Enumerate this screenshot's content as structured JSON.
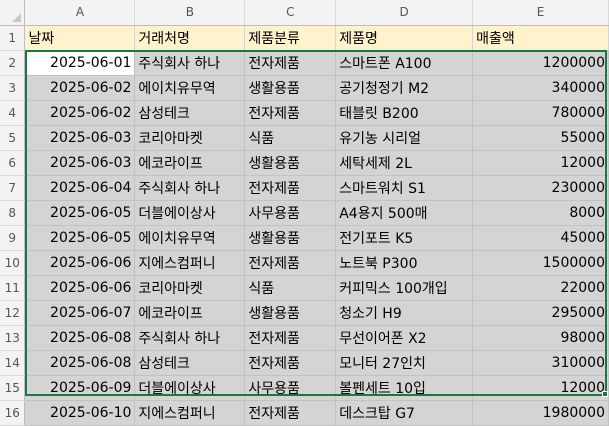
{
  "columns": [
    "A",
    "B",
    "C",
    "D",
    "E"
  ],
  "header": {
    "row_num": "1",
    "cells": [
      "날짜",
      "거래처명",
      "제품분류",
      "제품명",
      "매출액"
    ]
  },
  "rows": [
    {
      "n": "2",
      "date": "2025-06-01",
      "client": "주식회사 하나",
      "category": "전자제품",
      "product": "스마트폰 A100",
      "sales": "1200000"
    },
    {
      "n": "3",
      "date": "2025-06-02",
      "client": "에이치유무역",
      "category": "생활용품",
      "product": "공기청정기 M2",
      "sales": "340000"
    },
    {
      "n": "4",
      "date": "2025-06-02",
      "client": "삼성테크",
      "category": "전자제품",
      "product": "태블릿 B200",
      "sales": "780000"
    },
    {
      "n": "5",
      "date": "2025-06-03",
      "client": "코리아마켓",
      "category": "식품",
      "product": "유기농 시리얼",
      "sales": "55000"
    },
    {
      "n": "6",
      "date": "2025-06-03",
      "client": "에코라이프",
      "category": "생활용품",
      "product": "세탁세제 2L",
      "sales": "12000"
    },
    {
      "n": "7",
      "date": "2025-06-04",
      "client": "주식회사 하나",
      "category": "전자제품",
      "product": "스마트워치 S1",
      "sales": "230000"
    },
    {
      "n": "8",
      "date": "2025-06-05",
      "client": "더블에이상사",
      "category": "사무용품",
      "product": "A4용지 500매",
      "sales": "8000"
    },
    {
      "n": "9",
      "date": "2025-06-05",
      "client": "에이치유무역",
      "category": "생활용품",
      "product": "전기포트 K5",
      "sales": "45000"
    },
    {
      "n": "10",
      "date": "2025-06-06",
      "client": "지에스컴퍼니",
      "category": "전자제품",
      "product": "노트북 P300",
      "sales": "1500000"
    },
    {
      "n": "11",
      "date": "2025-06-06",
      "client": "코리아마켓",
      "category": "식품",
      "product": "커피믹스 100개입",
      "sales": "22000"
    },
    {
      "n": "12",
      "date": "2025-06-07",
      "client": "에코라이프",
      "category": "생활용품",
      "product": "청소기 H9",
      "sales": "295000"
    },
    {
      "n": "13",
      "date": "2025-06-08",
      "client": "주식회사 하나",
      "category": "전자제품",
      "product": "무선이어폰 X2",
      "sales": "98000"
    },
    {
      "n": "14",
      "date": "2025-06-08",
      "client": "삼성테크",
      "category": "전자제품",
      "product": "모니터 27인치",
      "sales": "310000"
    },
    {
      "n": "15",
      "date": "2025-06-09",
      "client": "더블에이상사",
      "category": "사무용품",
      "product": "볼펜세트 10입",
      "sales": "12000"
    },
    {
      "n": "16",
      "date": "2025-06-10",
      "client": "지에스컴퍼니",
      "category": "전자제품",
      "product": "데스크탑 G7",
      "sales": "1980000"
    }
  ],
  "colors": {
    "header_fill": "#fff2cc",
    "selection_fill": "#d4d4d4",
    "selection_border": "#217346"
  }
}
